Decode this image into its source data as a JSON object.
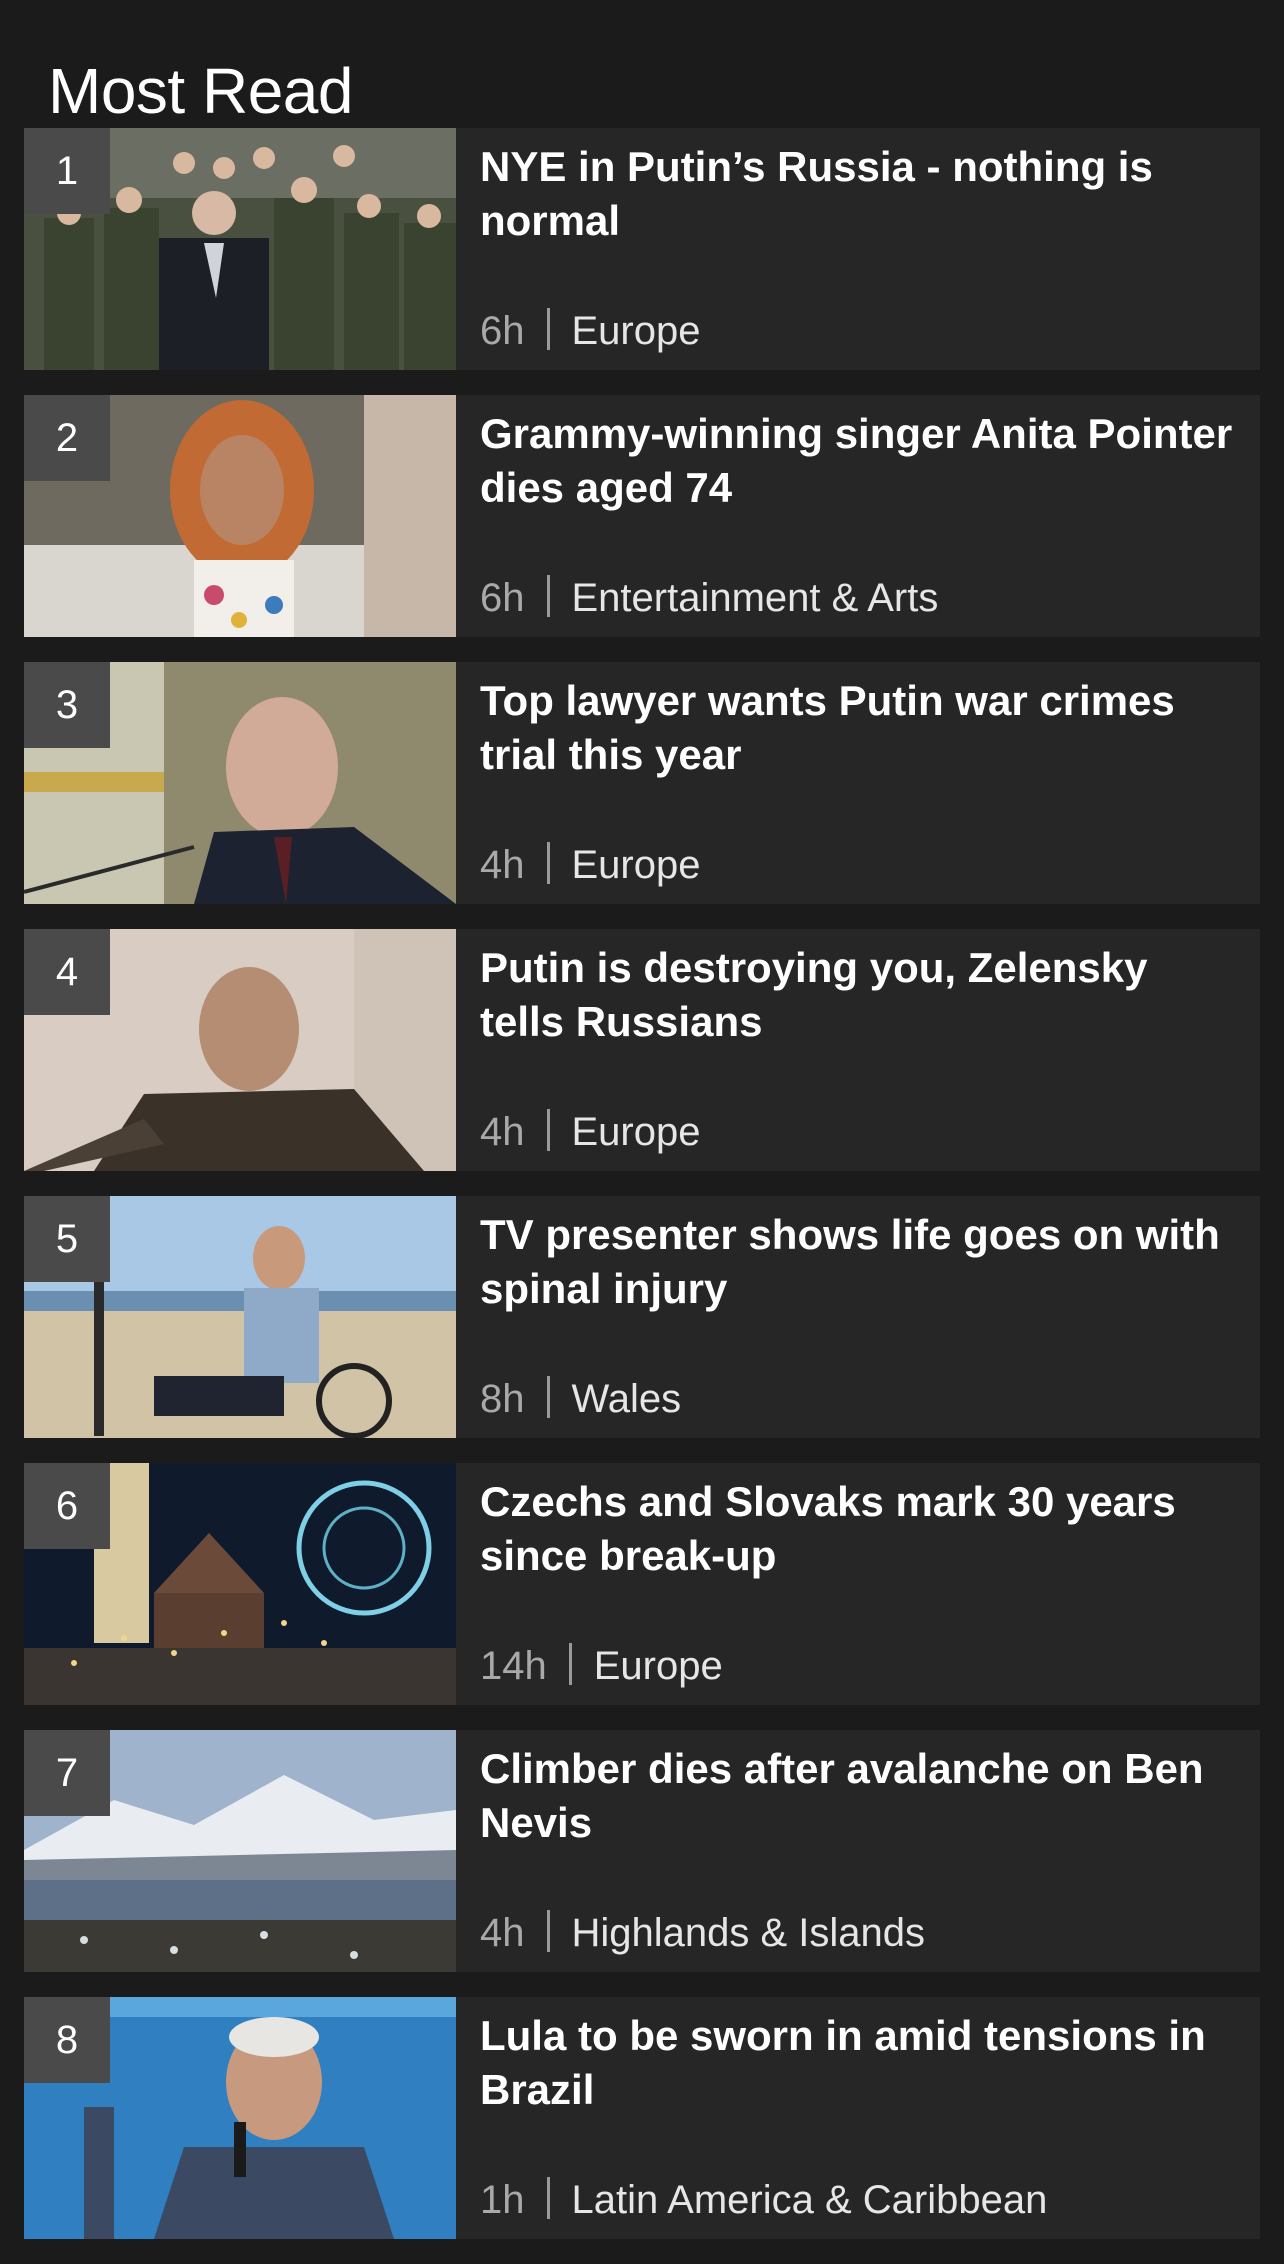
{
  "page": {
    "heading": "Most Read"
  },
  "items": [
    {
      "rank": "1",
      "title": "NYE in Putin’s Russia - nothing is normal",
      "age": "6h",
      "section": "Europe"
    },
    {
      "rank": "2",
      "title": "Grammy-winning singer Anita Pointer dies aged 74",
      "age": "6h",
      "section": "Entertainment & Arts"
    },
    {
      "rank": "3",
      "title": "Top lawyer wants Putin war crimes trial this year",
      "age": "4h",
      "section": "Europe"
    },
    {
      "rank": "4",
      "title": "Putin is destroying you, Zelensky tells Russians",
      "age": "4h",
      "section": "Europe"
    },
    {
      "rank": "5",
      "title": "TV presenter shows life goes on with spinal injury",
      "age": "8h",
      "section": "Wales"
    },
    {
      "rank": "6",
      "title": "Czechs and Slovaks mark 30 years since break-up",
      "age": "14h",
      "section": "Europe"
    },
    {
      "rank": "7",
      "title": "Climber dies after avalanche on Ben Nevis",
      "age": "4h",
      "section": "Highlands & Islands"
    },
    {
      "rank": "8",
      "title": "Lula to be sworn in amid tensions in Brazil",
      "age": "1h",
      "section": "Latin America & Caribbean"
    }
  ],
  "colors": {
    "background": "#1b1b1b",
    "card": "#262626",
    "rank_badge": "#4a4a4a",
    "meta_grey": "#a9a9a9"
  }
}
